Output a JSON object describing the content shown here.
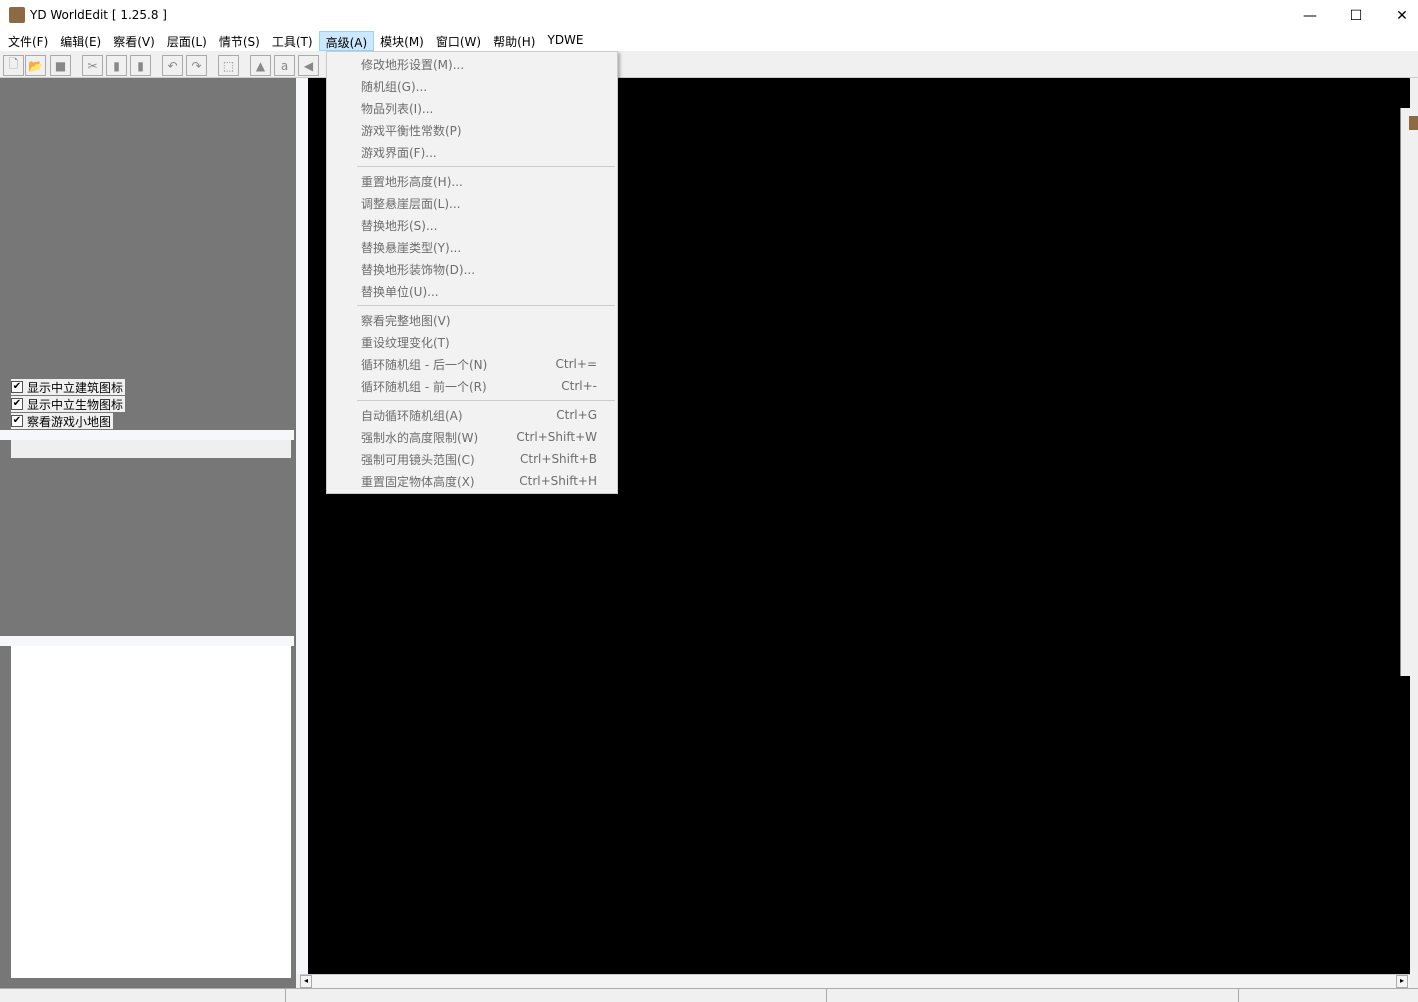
{
  "window": {
    "title": "YD WorldEdit [ 1.25.8 ]",
    "minimize": "—",
    "maximize": "☐",
    "close": "✕"
  },
  "menubar": [
    "文件(F)",
    "编辑(E)",
    "察看(V)",
    "层面(L)",
    "情节(S)",
    "工具(T)",
    "高级(A)",
    "模块(M)",
    "窗口(W)",
    "帮助(H)",
    "YDWE"
  ],
  "toolbar": {
    "icons": [
      "new-icon",
      "open-icon",
      "save-icon",
      "cut-icon",
      "copy-icon",
      "paste-icon",
      "undo-icon",
      "redo-icon",
      "select-icon",
      "terrain-icon",
      "doodad-icon",
      "sound-icon"
    ],
    "glyphs": [
      "🗋",
      "📂",
      "■",
      "✂",
      "▮",
      "▮",
      "↶",
      "↷",
      "⬚",
      "▲",
      "a",
      "◀"
    ]
  },
  "left_panel": {
    "checkboxes": [
      {
        "label": "显示中立建筑图标",
        "checked": true
      },
      {
        "label": "显示中立生物图标",
        "checked": true
      },
      {
        "label": "察看游戏小地图",
        "checked": true
      }
    ]
  },
  "advanced_menu": {
    "groups": [
      [
        {
          "label": "修改地形设置(M)...",
          "shortcut": ""
        },
        {
          "label": "随机组(G)...",
          "shortcut": ""
        },
        {
          "label": "物品列表(I)...",
          "shortcut": ""
        },
        {
          "label": "游戏平衡性常数(P)",
          "shortcut": ""
        },
        {
          "label": "游戏界面(F)...",
          "shortcut": ""
        }
      ],
      [
        {
          "label": "重置地形高度(H)...",
          "shortcut": ""
        },
        {
          "label": "调整悬崖层面(L)...",
          "shortcut": ""
        },
        {
          "label": "替换地形(S)...",
          "shortcut": ""
        },
        {
          "label": "替换悬崖类型(Y)...",
          "shortcut": ""
        },
        {
          "label": "替换地形装饰物(D)...",
          "shortcut": ""
        },
        {
          "label": "替换单位(U)...",
          "shortcut": ""
        }
      ],
      [
        {
          "label": "察看完整地图(V)",
          "shortcut": ""
        },
        {
          "label": "重设纹理变化(T)",
          "shortcut": ""
        },
        {
          "label": "循环随机组 - 后一个(N)",
          "shortcut": "Ctrl+="
        },
        {
          "label": "循环随机组 - 前一个(R)",
          "shortcut": "Ctrl+-"
        }
      ],
      [
        {
          "label": "自动循环随机组(A)",
          "shortcut": "Ctrl+G"
        },
        {
          "label": "强制水的高度限制(W)",
          "shortcut": "Ctrl+Shift+W"
        },
        {
          "label": "强制可用镜头范围(C)",
          "shortcut": "Ctrl+Shift+B"
        },
        {
          "label": "重置固定物体高度(X)",
          "shortcut": "Ctrl+Shift+H"
        }
      ]
    ]
  }
}
